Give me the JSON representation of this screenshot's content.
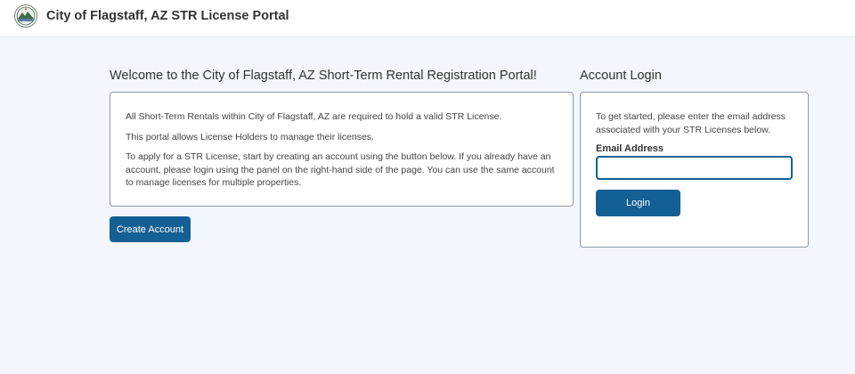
{
  "header": {
    "title": "City of Flagstaff, AZ STR License Portal",
    "logo_icon": "city-seal-icon"
  },
  "welcome": {
    "title": "Welcome to the City of Flagstaff, AZ Short-Term Rental Registration Portal!",
    "paragraphs": [
      "All Short-Term Rentals within City of Flagstaff, AZ are required to hold a valid STR License.",
      "This portal allows License Holders to manage their licenses.",
      "To apply for a STR License, start by creating an account using the button below. If you already have an account, please login using the panel on the right-hand side of the page. You can use the same account to manage licenses for multiple properties."
    ],
    "create_account_label": "Create Account"
  },
  "login": {
    "title": "Account Login",
    "intro": "To get started, please enter the email address associated with your STR Licenses below.",
    "email_label": "Email Address",
    "email_value": "",
    "email_placeholder": "",
    "login_label": "Login"
  },
  "colors": {
    "primary": "#145f93",
    "background": "#f3f6fc",
    "border": "#8f98a6"
  }
}
